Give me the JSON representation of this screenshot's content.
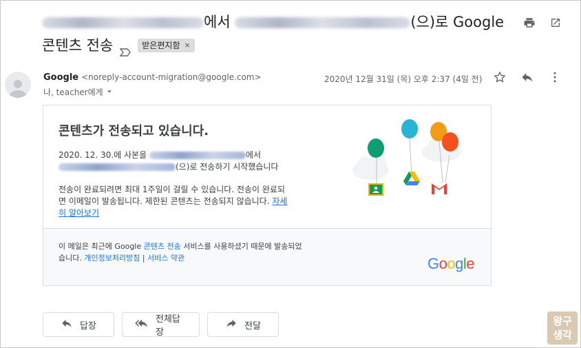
{
  "subject": {
    "part1": "에서",
    "part2": "(으)로 Google",
    "line2": "콘텐츠 전송",
    "label": "받은편지함",
    "label_close": "×"
  },
  "sender": {
    "name": "Google",
    "email": "<noreply-account-migration@google.com>",
    "to": "나, teacher에게",
    "date": "2020년 12월 31일 (목) 오후 2:37 (4일 전)"
  },
  "card": {
    "title": "콘텐츠가 전송되고 있습니다.",
    "p1_a": "2020. 12. 30.에 사본을",
    "p1_b": "에서",
    "p1_c": "(으)로 전송하기 시작했습니다",
    "p2": "전송이 완료되려면 최대 1주일이 걸릴 수 있습니다. 전송이 완료되면 이메일이 발송됩니다. 제한된 콘텐츠는 전송되지 않습니다.",
    "p2_link": "자세히 알아보기",
    "footer_a": "이 메일은 최근에 Google",
    "footer_link1": "콘텐츠 전송",
    "footer_b": "서비스를 사용하셨기 때문에 발송되었습니다.",
    "footer_link2": "개인정보처리방침",
    "footer_sep": "|",
    "footer_link3": "서비스 약관"
  },
  "logo": [
    "G",
    "o",
    "o",
    "g",
    "l",
    "e"
  ],
  "logo_colors": [
    "#4285f4",
    "#ea4335",
    "#fbbc05",
    "#4285f4",
    "#34a853",
    "#ea4335"
  ],
  "actions": {
    "reply": "답장",
    "reply_all": "전체답장",
    "forward": "전달"
  },
  "watermark": [
    "왕구",
    "생각"
  ],
  "icons": {
    "print": "print-icon",
    "popout": "open-in-new-icon",
    "star": "star-icon",
    "reply": "reply-icon",
    "more": "more-vert-icon"
  }
}
